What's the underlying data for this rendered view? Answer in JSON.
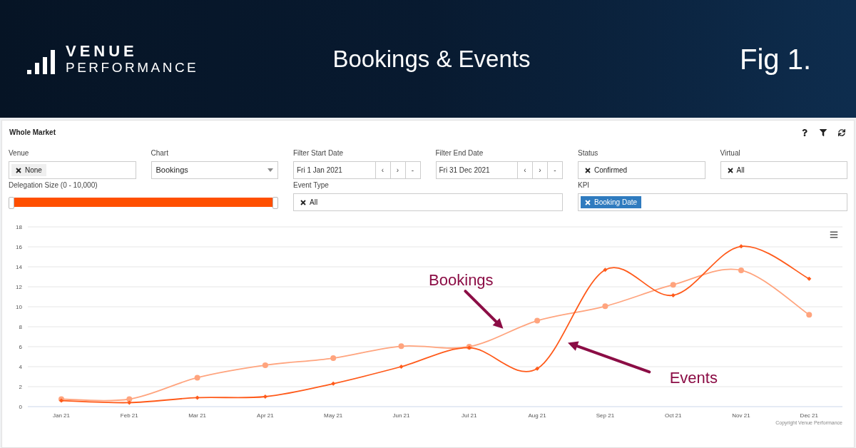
{
  "header": {
    "logo": {
      "line_1": "VENUE",
      "line_2": "PERFORMANCE"
    },
    "title": "Bookings & Events",
    "figure_label": "Fig 1."
  },
  "panel": {
    "title": "Whole Market",
    "filter_rows": [
      [
        {
          "kind": "tags",
          "label": "Venue",
          "tags": [
            {
              "text": "None",
              "kind": "muted"
            }
          ]
        },
        {
          "kind": "select",
          "label": "Chart",
          "value": "Bookings"
        },
        {
          "kind": "date",
          "label": "Filter Start Date",
          "value": "Fri 1 Jan 2021",
          "buttons": [
            "‹",
            "›",
            "-"
          ]
        },
        {
          "kind": "date",
          "label": "Filter End Date",
          "value": "Fri 31 Dec 2021",
          "buttons": [
            "‹",
            "›",
            "-"
          ]
        },
        {
          "kind": "tags",
          "label": "Status",
          "tags": [
            {
              "text": "Confirmed",
              "kind": "plain"
            }
          ]
        },
        {
          "kind": "tags",
          "label": "Virtual",
          "tags": [
            {
              "text": "All",
              "kind": "plain"
            }
          ]
        }
      ],
      [
        {
          "kind": "slider",
          "label": "Delegation Size (0 - 10,000)",
          "level": 1
        },
        {
          "kind": "tags",
          "label": "Event Type",
          "tags": [
            {
              "text": "All",
              "kind": "plain"
            }
          ]
        },
        {
          "kind": "tags",
          "label": "KPI",
          "tags": [
            {
              "text": "Booking Date",
              "kind": "active"
            }
          ]
        }
      ]
    ],
    "chart_data": {
      "type": "line",
      "categories": [
        "Jan 21",
        "Feb 21",
        "Mar 21",
        "Apr 21",
        "May 21",
        "Jun 21",
        "Jul 21",
        "Aug 21",
        "Sep 21",
        "Oct 21",
        "Nov 21",
        "Dec 21"
      ],
      "series": [
        {
          "color": "#ffa47e",
          "marker": "circle",
          "values": [
            0.75,
            0.75,
            2.9,
            4.15,
            4.85,
            6.05,
            6.0,
            8.6,
            10.05,
            12.2,
            13.65,
            9.2
          ]
        },
        {
          "color": "#ff5a1a",
          "marker": "diamond",
          "values": [
            0.6,
            0.4,
            0.9,
            1.0,
            2.3,
            4.0,
            5.9,
            3.8,
            13.7,
            11.15,
            16.05,
            12.8
          ]
        }
      ],
      "ylim": [
        0,
        18
      ],
      "yticks": [
        0,
        2,
        4,
        6,
        8,
        10,
        12,
        14,
        16,
        18
      ],
      "grid": true,
      "annotations": [
        "Bookings",
        "Events"
      ]
    },
    "credit": "Copyright Venue Performance"
  }
}
